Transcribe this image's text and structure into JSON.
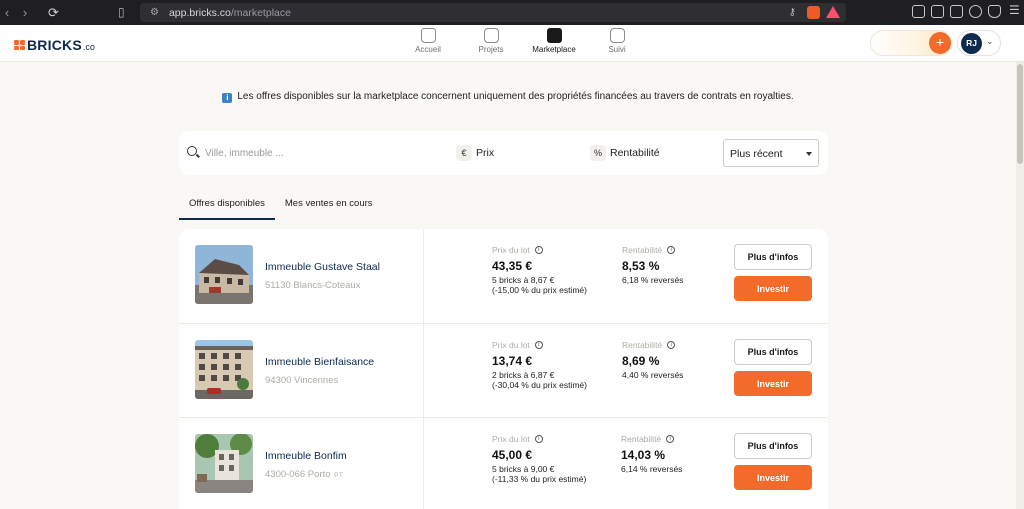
{
  "browser": {
    "url_host": "app.bricks.co",
    "url_path": "/marketplace"
  },
  "brand": {
    "name": "BRICKS",
    "tld": ".co",
    "accent": "#f26b2b",
    "navy": "#0e2a4d"
  },
  "nav": {
    "items": [
      {
        "label": "Accueil",
        "icon": "home-icon"
      },
      {
        "label": "Projets",
        "icon": "buildings-icon"
      },
      {
        "label": "Marketplace",
        "icon": "marketplace-icon",
        "active": true
      },
      {
        "label": "Suivi",
        "icon": "chart-icon"
      }
    ]
  },
  "user": {
    "initials": "RJ"
  },
  "notice": {
    "text": "Les offres disponibles sur la marketplace concernent uniquement des propriétés financées au travers de contrats en royalties."
  },
  "filters": {
    "search_placeholder": "Ville, immeuble ...",
    "price_symbol": "€",
    "price_label": "Prix",
    "yield_symbol": "%",
    "yield_label": "Rentabilité",
    "sort_value": "Plus récent"
  },
  "tabs": [
    {
      "label": "Offres disponibles",
      "active": true
    },
    {
      "label": "Mes ventes en cours",
      "active": false
    }
  ],
  "labels": {
    "price": "Prix du lot",
    "yield": "Rentabilité",
    "info_button": "Plus d'infos",
    "invest_button": "Investir"
  },
  "listings": [
    {
      "name": "Immeuble Gustave Staal",
      "location": "51130 Blancs-Coteaux",
      "country_code": "",
      "price": "43,35 €",
      "bricks": "5 bricks à 8,67 €",
      "discount": "(-15,00 % du prix estimé)",
      "yield": "8,53 %",
      "yield_paid": "6,18 % reversés"
    },
    {
      "name": "Immeuble Bienfaisance",
      "location": "94300 Vincennes",
      "country_code": "",
      "price": "13,74 €",
      "bricks": "2 bricks à 6,87 €",
      "discount": "(-30,04 % du prix estimé)",
      "yield": "8,69 %",
      "yield_paid": "4,40 % reversés"
    },
    {
      "name": "Immeuble Bonfim",
      "location": "4300-066 Porto",
      "country_code": "PT",
      "price": "45,00 €",
      "bricks": "5 bricks à 9,00 €",
      "discount": "(-11,33 % du prix estimé)",
      "yield": "14,03 %",
      "yield_paid": "6,14 % reversés"
    }
  ]
}
